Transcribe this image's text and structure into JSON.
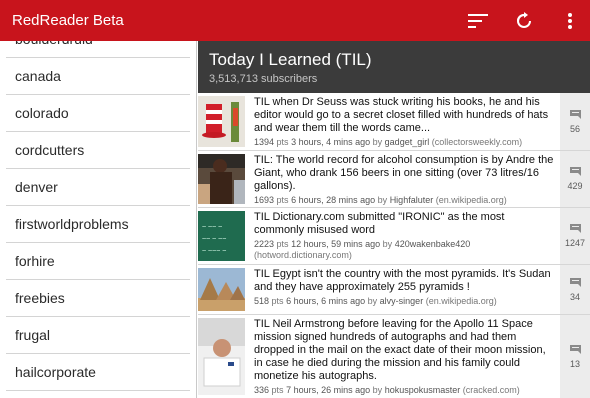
{
  "app": {
    "title": "RedReader Beta",
    "icons": [
      "sort-icon",
      "refresh-icon",
      "overflow-menu-icon"
    ]
  },
  "colors": {
    "appbar": "#c8141c",
    "subheader": "#3b3b3b",
    "comment_box": "#ececec"
  },
  "sidebar": {
    "items": [
      {
        "label": "boulderdruid"
      },
      {
        "label": "canada"
      },
      {
        "label": "colorado"
      },
      {
        "label": "cordcutters"
      },
      {
        "label": "denver"
      },
      {
        "label": "firstworldproblems"
      },
      {
        "label": "forhire"
      },
      {
        "label": "freebies"
      },
      {
        "label": "frugal"
      },
      {
        "label": "hailcorporate"
      }
    ]
  },
  "subreddit": {
    "title": "Today I Learned (TIL)",
    "subscribers": "3,513,713 subscribers"
  },
  "posts": [
    {
      "title": "TIL when Dr Seuss was stuck writing his books, he and his editor would go to a secret closet filled with hundreds of hats and wear them till the words came...",
      "pts": "1394",
      "time": "3 hours, 4 mins ago",
      "author": "gadget_girl",
      "domain": "(collectorsweekly.com)",
      "comments": "56",
      "thumb": "hat-thumbnail"
    },
    {
      "title": "TIL: The world record for alcohol consumption is by Andre the Giant, who drank 156 beers in one sitting (over 73 litres/16 gallons).",
      "pts": "1693",
      "time": "6 hours, 28 mins ago",
      "author": "Highfaluter",
      "domain": "(en.wikipedia.org)",
      "comments": "429",
      "thumb": "wrestler-thumbnail"
    },
    {
      "title": "TIL Dictionary.com submitted \"IRONIC\" as the most commonly misused word",
      "pts": "2223",
      "time": "12 hours, 59 mins ago",
      "author": "420wakenbake420",
      "domain": "(hotword.dictionary.com)",
      "comments": "1247",
      "thumb": "chalkboard-thumbnail"
    },
    {
      "title": "TIL Egypt isn't the country with the most pyramids. It's Sudan and they have approximately 255 pyramids !",
      "pts": "518",
      "time": "6 hours, 6 mins ago",
      "author": "alvy-singer",
      "domain": "(en.wikipedia.org)",
      "comments": "34",
      "thumb": "pyramids-thumbnail"
    },
    {
      "title": "TIL Neil Armstrong before leaving for the Apollo 11 Space mission signed hundreds of autographs and had them dropped in the mail on the exact date of their moon mission, in case he died during the mission and his family could monetize his autographs.",
      "pts": "336",
      "time": "7 hours, 26 mins ago",
      "author": "hokuspokusmaster",
      "domain": "(cracked.com)",
      "comments": "13",
      "thumb": "astronaut-thumbnail"
    }
  ],
  "labels": {
    "pts": "pts",
    "by": "by"
  }
}
